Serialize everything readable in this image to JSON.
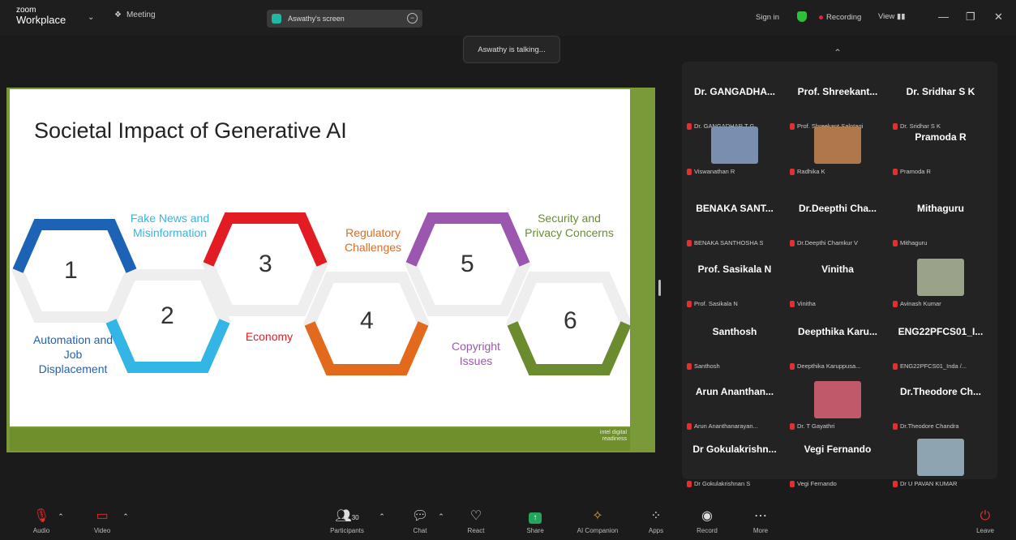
{
  "app": {
    "logo_small": "zoom",
    "logo_big": "Workplace",
    "meeting_label": "Meeting"
  },
  "screen_pill": {
    "label": "Aswathy's screen"
  },
  "topright": {
    "sign_in": "Sign in",
    "recording": "Recording",
    "view": "View"
  },
  "talking": "Aswathy is talking...",
  "slide": {
    "title": "Societal Impact of Generative AI",
    "footer": "intel digital readiness",
    "numbers": [
      "1",
      "2",
      "3",
      "4",
      "5",
      "6"
    ],
    "labels": {
      "fake_news": "Fake News and Misinformation",
      "regulatory": "Regulatory Challenges",
      "security": "Security and Privacy Concerns",
      "automation": "Automation and Job Displacement",
      "economy": "Economy",
      "copyright": "Copyright Issues"
    }
  },
  "participants": [
    {
      "name": "Dr. GANGADHA...",
      "sub": "Dr. GANGADHAR T G"
    },
    {
      "name": "Prof. Shreekant...",
      "sub": "Prof. Shreekant Salotagi"
    },
    {
      "name": "Dr. Sridhar S K",
      "sub": "Dr. Sridhar S K"
    },
    {
      "name": "",
      "sub": "Viswanathan R"
    },
    {
      "name": "",
      "sub": "Radhika K"
    },
    {
      "name": "Pramoda R",
      "sub": "Pramoda R"
    },
    {
      "name": "BENAKA SANT...",
      "sub": "BENAKA SANTHOSHA S"
    },
    {
      "name": "Dr.Deepthi Cha...",
      "sub": "Dr.Deepthi Chamkur V"
    },
    {
      "name": "Mithaguru",
      "sub": "Mithaguru"
    },
    {
      "name": "Prof. Sasikala N",
      "sub": "Prof. Sasikala N"
    },
    {
      "name": "Vinitha",
      "sub": "Vinitha"
    },
    {
      "name": "",
      "sub": "Avinash Kumar"
    },
    {
      "name": "Santhosh",
      "sub": "Santhosh"
    },
    {
      "name": "Deepthika Karu...",
      "sub": "Deepthika Karuppusa..."
    },
    {
      "name": "ENG22PFCS01_I...",
      "sub": "ENG22PFCS01_Inda /..."
    },
    {
      "name": "Arun Ananthan...",
      "sub": "Arun Ananthanarayan..."
    },
    {
      "name": "",
      "sub": "Dr. T Gayathri"
    },
    {
      "name": "Dr.Theodore Ch...",
      "sub": "Dr.Theodore Chandra"
    },
    {
      "name": "Dr Gokulakrishn...",
      "sub": "Dr Gokulakrishnan S"
    },
    {
      "name": "Vegi Fernando",
      "sub": "Vegi Fernando"
    },
    {
      "name": "",
      "sub": "Dr U PAVAN KUMAR"
    }
  ],
  "toolbar": {
    "audio": "Audio",
    "video": "Video",
    "participants": "Participants",
    "participants_count": "30",
    "chat": "Chat",
    "react": "React",
    "share": "Share",
    "ai": "AI Companion",
    "apps": "Apps",
    "record": "Record",
    "more": "More",
    "leave": "Leave"
  }
}
